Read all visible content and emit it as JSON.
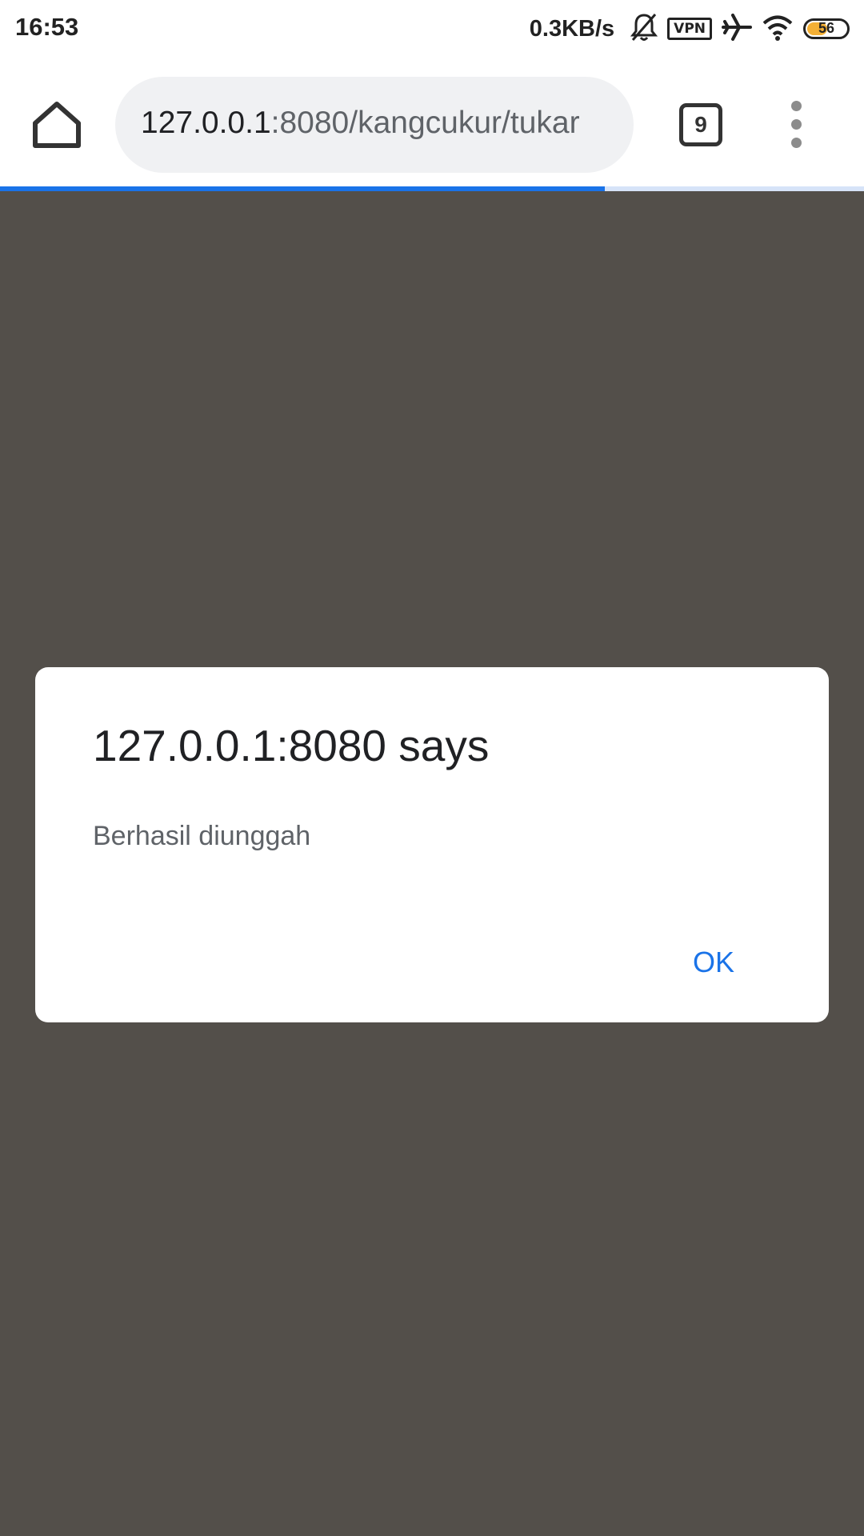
{
  "status_bar": {
    "time": "16:53",
    "net_speed": "0.3KB/s",
    "icons": [
      "bell-off-icon",
      "vpn-icon",
      "airplane-icon",
      "wifi-icon",
      "battery-icon"
    ],
    "vpn_label": "VPN",
    "battery_level": "56",
    "battery_fraction": 0.56,
    "battery_color": "#f4b035"
  },
  "browser": {
    "url_host": "127.0.0.1",
    "url_rest": ":8080/kangcukur/tukar",
    "tab_count": "9",
    "load_progress": 0.7,
    "accent_color": "#1a73e8"
  },
  "dialog": {
    "title": "127.0.0.1:8080 says",
    "message": "Berhasil diunggah",
    "ok_label": "OK"
  },
  "colors": {
    "overlay": "#534f4a",
    "dialog_bg": "#ffffff"
  }
}
